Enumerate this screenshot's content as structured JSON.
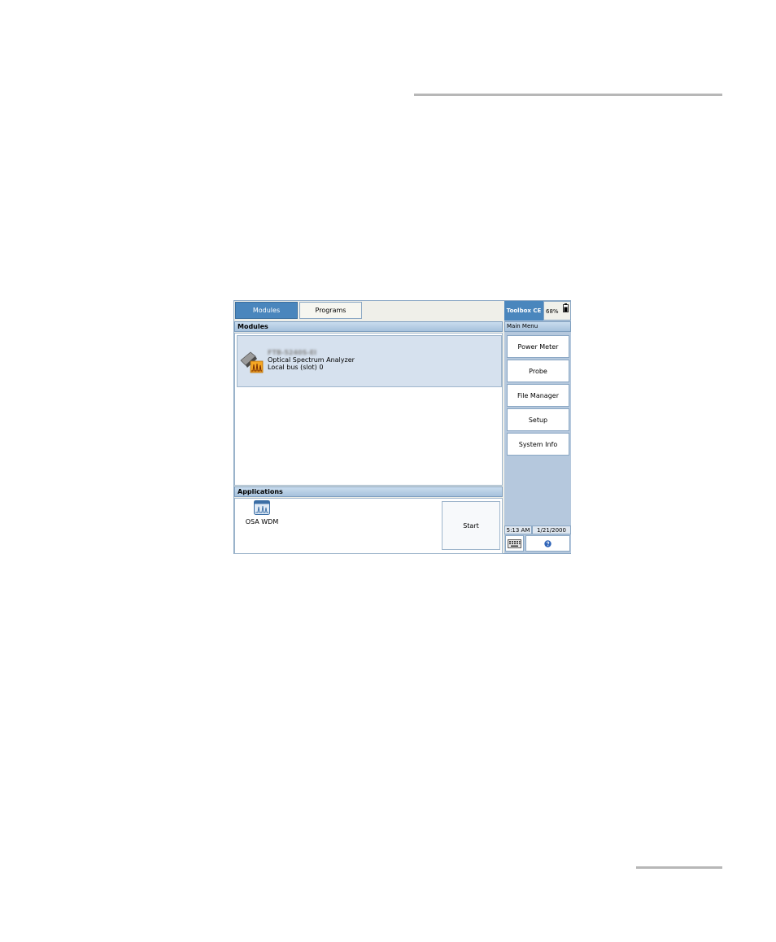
{
  "tabs": [
    {
      "label": "Modules",
      "active": true
    },
    {
      "label": "Programs",
      "active": false
    }
  ],
  "header": {
    "title": "Toolbox CE",
    "battery": "68%"
  },
  "modules": {
    "section_title": "Modules",
    "items": [
      {
        "model": "FTB-5240S-EI",
        "name": "Optical Spectrum Analyzer",
        "location": "Local bus (slot) 0",
        "icon": "osa-module-icon"
      }
    ]
  },
  "applications": {
    "section_title": "Applications",
    "items": [
      {
        "label": "OSA WDM",
        "icon": "osa-wdm-icon"
      }
    ],
    "start_label": "Start"
  },
  "main_menu": {
    "title": "Main Menu",
    "items": [
      "Power Meter",
      "Probe",
      "File Manager",
      "Setup",
      "System Info"
    ]
  },
  "status": {
    "time": "5:13 AM",
    "date": "1/21/2000"
  },
  "colors": {
    "accent": "#4a86bd",
    "panel": "#b5c8dd",
    "selected_row": "#d6e1ee"
  }
}
